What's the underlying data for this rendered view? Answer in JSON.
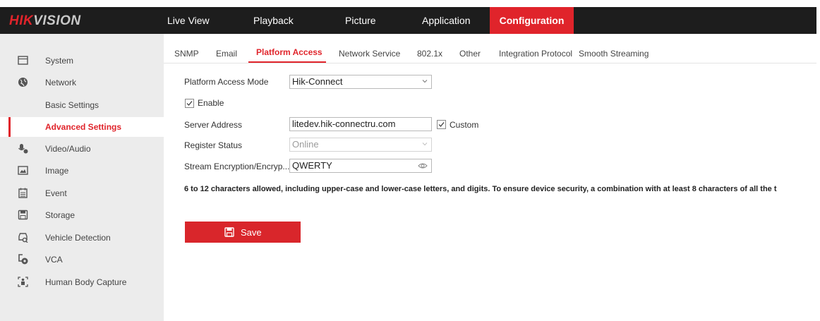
{
  "header": {
    "logo_part1": "HIK",
    "logo_part2": "VISION",
    "nav": [
      "Live View",
      "Playback",
      "Picture",
      "Application",
      "Configuration"
    ],
    "active_nav": "Configuration",
    "colors": {
      "bar": "#1d1d1d",
      "accent": "#e0242b"
    }
  },
  "sidebar": {
    "items": [
      {
        "label": "System",
        "icon": "monitor-icon"
      },
      {
        "label": "Network",
        "icon": "globe-icon"
      },
      {
        "label": "Basic Settings"
      },
      {
        "label": "Advanced Settings",
        "active": true
      },
      {
        "label": "Video/Audio",
        "icon": "mic-person-icon"
      },
      {
        "label": "Image",
        "icon": "image-icon"
      },
      {
        "label": "Event",
        "icon": "calendar-icon"
      },
      {
        "label": "Storage",
        "icon": "storage-icon"
      },
      {
        "label": "Vehicle Detection",
        "icon": "vehicle-icon"
      },
      {
        "label": "VCA",
        "icon": "vca-icon"
      },
      {
        "label": "Human Body Capture",
        "icon": "body-capture-icon"
      }
    ]
  },
  "tabs": [
    "SNMP",
    "Email",
    "Platform Access",
    "Network Service",
    "802.1x",
    "Other",
    "Integration Protocol",
    "Smooth Streaming"
  ],
  "active_tab": "Platform Access",
  "form": {
    "mode_label": "Platform Access Mode",
    "mode_value": "Hik-Connect",
    "enable_label": "Enable",
    "enable_checked": true,
    "server_label": "Server Address",
    "server_value": "litedev.hik-connectru.com",
    "custom_label": "Custom",
    "custom_checked": true,
    "register_label": "Register Status",
    "register_value": "Online",
    "encryption_label": "Stream Encryption/Encryp...",
    "encryption_value": "QWERTY",
    "hint": "6 to 12 characters allowed, including upper-case and lower-case letters, and digits. To ensure device security, a combination with at least 8 characters of all the t",
    "save_label": "Save"
  }
}
